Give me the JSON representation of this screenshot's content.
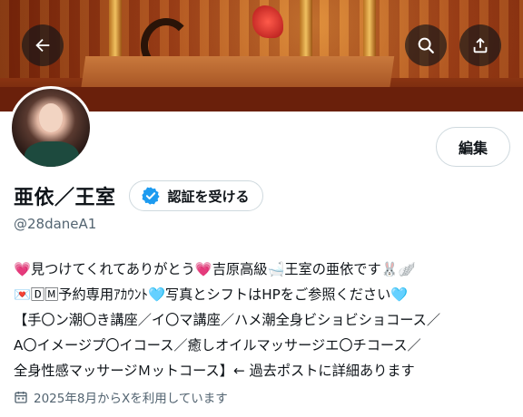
{
  "header": {
    "back_icon": "arrow-left-icon",
    "search_icon": "search-icon",
    "share_icon": "share-upload-icon"
  },
  "profile": {
    "display_name": "亜依／王室",
    "handle": "@28daneA1",
    "edit_label": "編集",
    "verify_label": "認証を受ける",
    "verify_icon": "verified-badge-icon",
    "accent_color": "#1d9bf0"
  },
  "bio": {
    "lines": [
      "💗見つけてくれてありがとう💗吉原高級🛁王室の亜依です🐰🪽",
      "💌🄳🄼予約専用ｱｶｳﾝﾄ🩵写真とシフトはHPをご参照ください🩵",
      "【手〇ン潮〇き講座／イ〇マ講座／ハメ潮全身ビショビショコース／",
      "A〇イメージプ〇イコース／癒しオイルマッサージエ〇チコース／",
      "全身性感マッサージＭットコース】← 過去ポストに詳細あります"
    ]
  },
  "joined": {
    "icon": "calendar-icon",
    "text": "2025年8月からXを利用しています"
  }
}
